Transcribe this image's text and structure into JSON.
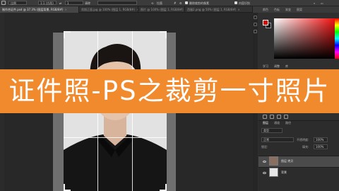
{
  "optbar": {
    "ratio_select": "比例",
    "field_1": "1:1 (方形)",
    "field_2": "1",
    "clear_label": "清除",
    "straighten_label": "拉直",
    "delete_cropped_label": "删除裁剪的像素",
    "content_aware_label": "内容识别"
  },
  "tabs": [
    {
      "label": "制作合证件.psd @ 37.3% (图层背景, RGB/8#)",
      "active": true
    },
    {
      "label": "男照正面.jpg @ 100% (图层 1, RGB/8#)",
      "active": false
    },
    {
      "label": "照片 @ 100% (图层 1, RGB/8#)",
      "active": false
    },
    {
      "label": "西服2.png @ 50% (图层 1, RGB/8#)",
      "active": false
    }
  ],
  "right_tabs": [
    "颜色",
    "色板",
    "渐变",
    "图案"
  ],
  "adjustments": {
    "header_tabs": [
      "学习",
      "调整",
      "库"
    ]
  },
  "layers": {
    "tabs": [
      "图层",
      "通道",
      "路径"
    ],
    "kind_label": "类型",
    "blend_mode": "正常",
    "opacity_label": "不透明度:",
    "opacity_value": "100%",
    "lock_label": "锁定:",
    "fill_label": "填充:",
    "fill_value": "100%",
    "rows": [
      {
        "name": "图层 拷贝",
        "selected": true
      },
      {
        "name": "背景",
        "selected": false
      }
    ]
  },
  "banner": {
    "text": "证件照-PS之裁剪一寸照片"
  },
  "colors": {
    "banner": "#f08a2c",
    "foreground_swatch": "#e00000",
    "background_swatch": "#111111"
  }
}
